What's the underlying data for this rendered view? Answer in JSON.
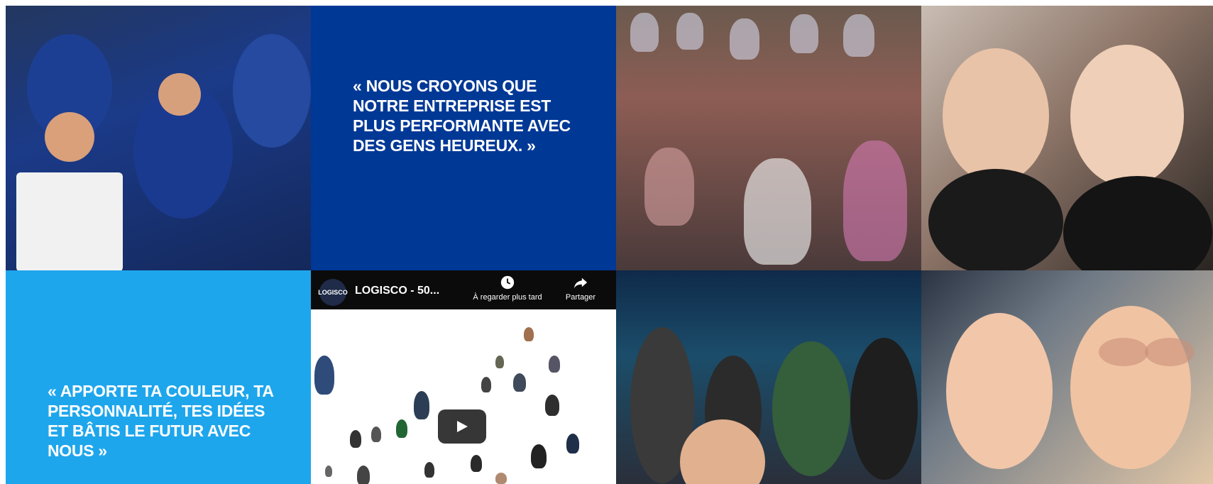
{
  "tiles": {
    "quote_1": "« NOUS CROYONS QUE NOTRE ENTREPRISE EST PLUS PERFORMANTE AVEC DES GENS HEUREUX. »",
    "quote_2": "« APPORTE TA COULEUR, TA PERSONNALITÉ, TES IDÉES ET BÂTIS LE FUTUR AVEC NOUS »"
  },
  "video": {
    "channel": "LOGISCO",
    "title": "LOGISCO - 50...",
    "watch_later_label": "À regarder plus tard",
    "share_label": "Partager",
    "watch_later_icon": "clock-icon",
    "share_icon": "share-arrow-icon",
    "play_icon": "play-icon"
  },
  "colors": {
    "quote_dark_bg": "#003896",
    "quote_light_bg": "#1ea6ec"
  }
}
